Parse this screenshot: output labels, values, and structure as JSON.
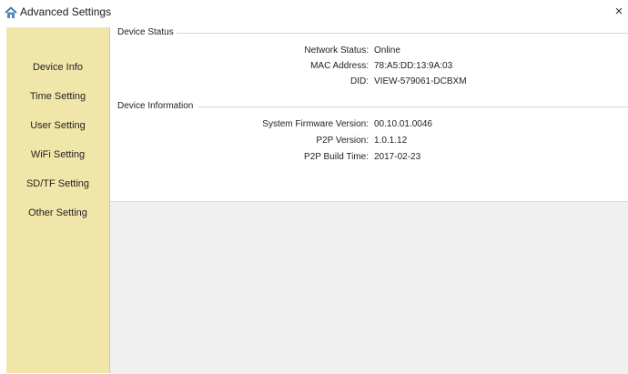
{
  "window": {
    "title": "Advanced Settings",
    "icon": "house-gear-icon",
    "close_label": "×"
  },
  "sidebar": {
    "items": [
      {
        "label": "Device Info"
      },
      {
        "label": "Time Setting"
      },
      {
        "label": "User Setting"
      },
      {
        "label": "WiFi Setting"
      },
      {
        "label": "SD/TF Setting"
      },
      {
        "label": "Other Setting"
      }
    ]
  },
  "device_status": {
    "title": "Device Status",
    "rows": [
      {
        "label": "Network Status:",
        "value": "Online"
      },
      {
        "label": "MAC Address:",
        "value": "78:A5:DD:13:9A:03"
      },
      {
        "label": "DID:",
        "value": "VIEW-579061-DCBXM"
      }
    ]
  },
  "device_information": {
    "title": "Device Information",
    "rows": [
      {
        "label": "System Firmware Version:",
        "value": "00.10.01.0046"
      },
      {
        "label": "P2P Version:",
        "value": "1.0.1.12"
      },
      {
        "label": "P2P Build Time:",
        "value": "2017-02-23"
      }
    ]
  },
  "colors": {
    "sidebar_bg": "#f1e6aa",
    "lower_panel_bg": "#f0f0f0"
  }
}
